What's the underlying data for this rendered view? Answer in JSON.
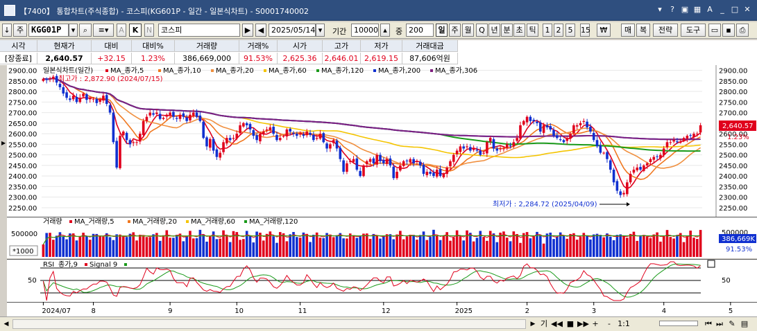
{
  "window": {
    "title": "【7400】 통합차트(주식종합) - 코스피(KG601P - 일간 - 일본식차트) - S0001740002",
    "icons": [
      "pin-icon",
      "help-icon",
      "window-icon",
      "grid-icon",
      "font-icon",
      "minimize-icon",
      "maximize-icon",
      "close-icon"
    ]
  },
  "toolbar": {
    "label_ju": "주",
    "code": "KGG01P",
    "k_label": "K",
    "name": "코스피",
    "date": "2025/05/14",
    "period_label": "기간",
    "period_value": "10000",
    "count_label": "중",
    "count_value": "200",
    "intervals": [
      "일",
      "주",
      "월",
      "Q",
      "년",
      "분",
      "초",
      "틱",
      "1",
      "2",
      "5",
      "15"
    ],
    "active_interval": "일",
    "currency": "₩",
    "buy_label": "매",
    "copy_label": "복",
    "strategy_label": "전략",
    "tools_label": "도구"
  },
  "quote": {
    "labels": [
      "시각",
      "현재가",
      "대비",
      "대비%",
      "거래량",
      "거래%",
      "시가",
      "고가",
      "저가",
      "거래대금"
    ],
    "values": [
      "[장종료]",
      "2,640.57",
      "+32.15",
      "1.23%",
      "386,669,000",
      "91.53%",
      "2,625.36",
      "2,646.01",
      "2,619.15",
      "87,606억원"
    ]
  },
  "chart": {
    "legend_label": "일본식차트(일간)",
    "legend_items": [
      {
        "name": "MA_종가,5",
        "color": "#e0001c"
      },
      {
        "name": "MA_종가,10",
        "color": "#f07820"
      },
      {
        "name": "MA_종가,20",
        "color": "#f09040"
      },
      {
        "name": "MA_종가,60",
        "color": "#f4c400"
      },
      {
        "name": "MA_종가,120",
        "color": "#1a9a1a"
      },
      {
        "name": "MA_종가,200",
        "color": "#1030d0"
      },
      {
        "name": "MA_종가,306",
        "color": "#802080"
      }
    ],
    "high_annotation": "최고가 : 2,872.90 (2024/07/15)",
    "low_annotation": "최저가 : 2,284.72 (2025/04/09)",
    "current_price_tag": "2,640.57",
    "current_pct_tag": "1.23%",
    "y_ticks": [
      "2900.00",
      "2850.00",
      "2800.00",
      "2750.00",
      "2700.00",
      "2650.00",
      "2600.00",
      "2550.00",
      "2500.00",
      "2450.00",
      "2400.00",
      "2350.00",
      "2300.00",
      "2250.00"
    ],
    "y_tick_values": [
      2900,
      2850,
      2800,
      2750,
      2700,
      2650,
      2600,
      2550,
      2500,
      2450,
      2400,
      2350,
      2300,
      2250
    ],
    "ylim": [
      2240,
      2905
    ],
    "closes": [
      2860,
      2855,
      2862,
      2870,
      2842,
      2820,
      2790,
      2770,
      2760,
      2780,
      2750,
      2770,
      2790,
      2760,
      2770,
      2765,
      2745,
      2760,
      2780,
      2741,
      2700,
      2560,
      2440,
      2590,
      2610,
      2570,
      2550,
      2560,
      2560,
      2600,
      2660,
      2680,
      2700,
      2690,
      2700,
      2670,
      2675,
      2690,
      2700,
      2680,
      2670,
      2690,
      2680,
      2660,
      2690,
      2700,
      2680,
      2660,
      2580,
      2540,
      2575,
      2520,
      2490,
      2510,
      2560,
      2580,
      2570,
      2580,
      2600,
      2640,
      2650,
      2640,
      2620,
      2590,
      2570,
      2600,
      2610,
      2620,
      2630,
      2600,
      2570,
      2580,
      2590,
      2620,
      2610,
      2600,
      2590,
      2600,
      2590,
      2610,
      2595,
      2570,
      2580,
      2600,
      2560,
      2530,
      2550,
      2570,
      2530,
      2480,
      2420,
      2460,
      2470,
      2480,
      2430,
      2400,
      2450,
      2470,
      2480,
      2460,
      2500,
      2470,
      2460,
      2480,
      2450,
      2390,
      2420,
      2450,
      2470,
      2470,
      2480,
      2460,
      2470,
      2450,
      2410,
      2420,
      2410,
      2400,
      2430,
      2400,
      2410,
      2440,
      2470,
      2500,
      2520,
      2540,
      2530,
      2540,
      2520,
      2530,
      2520,
      2500,
      2510,
      2560,
      2580,
      2530,
      2520,
      2530,
      2530,
      2550,
      2540,
      2560,
      2580,
      2640,
      2660,
      2680,
      2660,
      2660,
      2650,
      2610,
      2640,
      2630,
      2620,
      2590,
      2580,
      2570,
      2560,
      2580,
      2600,
      2640,
      2640,
      2650,
      2660,
      2630,
      2610,
      2570,
      2540,
      2510,
      2510,
      2480,
      2430,
      2370,
      2330,
      2310,
      2320,
      2370,
      2410,
      2430,
      2440,
      2430,
      2450,
      2460,
      2480,
      2490,
      2490,
      2500,
      2530,
      2560,
      2560,
      2570,
      2560,
      2560,
      2580,
      2590,
      2590,
      2600,
      2600,
      2640
    ],
    "ma_periods": [
      5,
      10,
      20,
      60,
      120,
      200,
      306
    ],
    "x_labels": [
      "2024/07",
      "8",
      "9",
      "10",
      "11",
      "12",
      "2025",
      "2",
      "3",
      "4",
      "5"
    ],
    "x_label_index": [
      0,
      15,
      38,
      58,
      77,
      102,
      124,
      145,
      165,
      186,
      206
    ]
  },
  "volume": {
    "legend_label": "거래량",
    "legend_items": [
      {
        "name": "MA_거래량,5",
        "color": "#e0001c"
      },
      {
        "name": "MA_거래량,20",
        "color": "#f07820"
      },
      {
        "name": "MA_거래량,60",
        "color": "#f4c400"
      },
      {
        "name": "MA_거래량,120",
        "color": "#1a9a1a"
      }
    ],
    "y_tick": "500000",
    "multiplier_label": "*1000",
    "current_tag": "386,669K",
    "pct_tag": "91.53%"
  },
  "rsi": {
    "legend_label": "RSI",
    "items": [
      {
        "name": "종가,9",
        "color": "#e0001c"
      },
      {
        "name": "Signal 9",
        "color": "#1a9a1a"
      }
    ],
    "level_label": "50"
  },
  "bottom": {
    "controls": [
      "기",
      "◀◀",
      "■",
      "▶▶",
      "+",
      "-",
      "1:1"
    ]
  }
}
